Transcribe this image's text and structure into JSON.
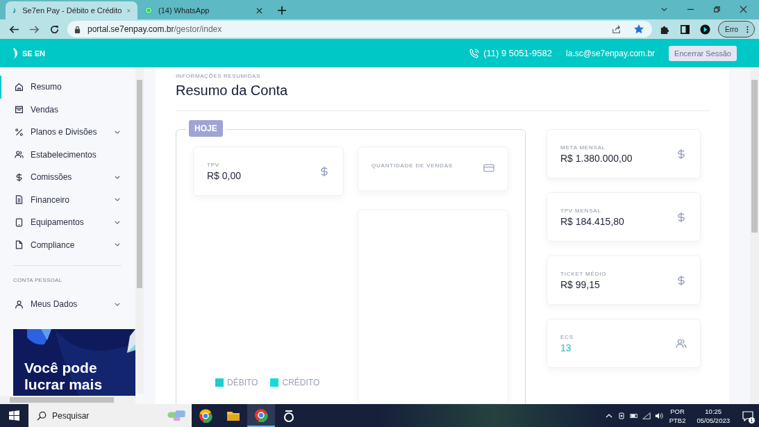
{
  "browser": {
    "tabs": [
      {
        "title": "Se7en Pay - Débito e Crédito",
        "selected": true,
        "kind": "app"
      },
      {
        "title": "(14) WhatsApp",
        "selected": false,
        "kind": "chat"
      }
    ],
    "url_host": "portal.se7enpay.com.br",
    "url_path": "/gestor/index",
    "bookmarked": true,
    "profile_label": "Erro"
  },
  "header": {
    "logo": "SE EN",
    "phone": "(11) 9 5051-9582",
    "email": "la.sc@se7enpay.com.br",
    "logout": "Encerrar Sessão"
  },
  "sidebar": {
    "items": [
      {
        "label": "Resumo",
        "kind": "home",
        "selected": true,
        "expandable": false
      },
      {
        "label": "Vendas",
        "kind": "bag",
        "selected": false,
        "expandable": false
      },
      {
        "label": "Planos e Divisões",
        "kind": "percent",
        "selected": false,
        "expandable": true
      },
      {
        "label": "Estabelecimentos",
        "kind": "users",
        "selected": false,
        "expandable": false
      },
      {
        "label": "Comissões",
        "kind": "dollar",
        "selected": false,
        "expandable": true
      },
      {
        "label": "Financeiro",
        "kind": "doc",
        "selected": false,
        "expandable": true
      },
      {
        "label": "Equipamentos",
        "kind": "device",
        "selected": false,
        "expandable": true
      },
      {
        "label": "Compliance",
        "kind": "file",
        "selected": false,
        "expandable": true
      }
    ],
    "section": "CONTA PESSOAL",
    "account_items": [
      {
        "label": "Meus Dados",
        "kind": "user",
        "selected": false,
        "expandable": true
      }
    ],
    "banner": {
      "kind": "picture",
      "text": "Você pode lucrar mais"
    }
  },
  "main": {
    "eyebrow": "INFORMAÇÕES RESUMIDAS",
    "title": "Resumo da Conta",
    "today": {
      "badge": "HOJE",
      "cards": [
        {
          "label": "TPV",
          "value": "R$ 0,00",
          "kind": "dollar"
        },
        {
          "label": "QUANTIDADE DE VENDAS",
          "kind": "card"
        }
      ],
      "legend": [
        {
          "label": "DÉBITO",
          "color": "#22cccc"
        },
        {
          "label": "CRÉDITO",
          "color": "#11dddd"
        }
      ]
    },
    "side_cards": [
      {
        "label": "META MENSAL",
        "value": "R$ 1.380.000,00",
        "kind": "dollar",
        "highlight": false
      },
      {
        "label": "TPV MENSAL",
        "value": "R$ 184.415,80",
        "kind": "dollar",
        "highlight": false
      },
      {
        "label": "TICKET MÉDIO",
        "value": "R$ 99,15",
        "kind": "dollar",
        "highlight": false
      },
      {
        "label": "ECS",
        "value": "13",
        "kind": "users",
        "highlight": true
      }
    ]
  },
  "taskbar": {
    "search_placeholder": "Pesquisar",
    "language": "POR",
    "layout": "PTB2",
    "time": "10:25",
    "date": "05/05/2023",
    "notifications": "1"
  }
}
